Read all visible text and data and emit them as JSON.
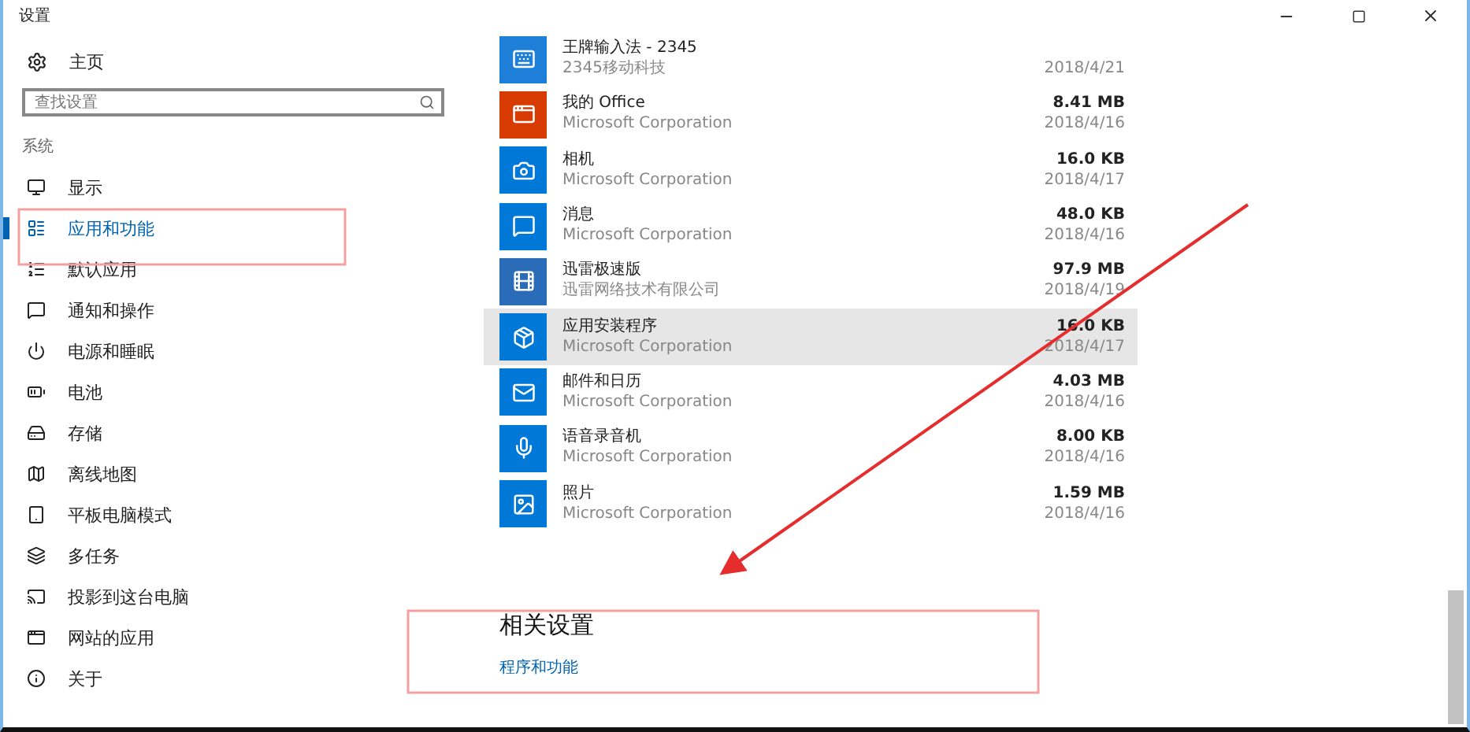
{
  "window": {
    "title": "设置"
  },
  "sidebar": {
    "home": "主页",
    "search": {
      "placeholder": "查找设置"
    },
    "section": "系统",
    "items": [
      {
        "label": "显示",
        "selected": false
      },
      {
        "label": "应用和功能",
        "selected": true
      },
      {
        "label": "默认应用",
        "selected": false
      },
      {
        "label": "通知和操作",
        "selected": false
      },
      {
        "label": "电源和睡眠",
        "selected": false
      },
      {
        "label": "电池",
        "selected": false
      },
      {
        "label": "存储",
        "selected": false
      },
      {
        "label": "离线地图",
        "selected": false
      },
      {
        "label": "平板电脑模式",
        "selected": false
      },
      {
        "label": "多任务",
        "selected": false
      },
      {
        "label": "投影到这台电脑",
        "selected": false
      },
      {
        "label": "网站的应用",
        "selected": false
      },
      {
        "label": "关于",
        "selected": false
      }
    ]
  },
  "apps": [
    {
      "name": "王牌输入法 - 2345",
      "publisher": "2345移动科技",
      "date": "2018/4/21",
      "color": "#1e7fd8",
      "selected": false
    },
    {
      "name": "我的 Office",
      "publisher": "Microsoft Corporation",
      "size": "8.41 MB",
      "date": "2018/4/16",
      "color": "#d83b01",
      "selected": false
    },
    {
      "name": "相机",
      "publisher": "Microsoft Corporation",
      "size": "16.0 KB",
      "date": "2018/4/17",
      "color": "#0078d7",
      "selected": false
    },
    {
      "name": "消息",
      "publisher": "Microsoft Corporation",
      "size": "48.0 KB",
      "date": "2018/4/16",
      "color": "#0078d7",
      "selected": false
    },
    {
      "name": "迅雷极速版",
      "publisher": "迅雷网络技术有限公司",
      "size": "97.9 MB",
      "date": "2018/4/19",
      "color": "#2b6cb8",
      "selected": false
    },
    {
      "name": "应用安装程序",
      "publisher": "Microsoft Corporation",
      "size": "16.0 KB",
      "date": "2018/4/17",
      "color": "#0078d7",
      "selected": true
    },
    {
      "name": "邮件和日历",
      "publisher": "Microsoft Corporation",
      "size": "4.03 MB",
      "date": "2018/4/16",
      "color": "#0078d7",
      "selected": false
    },
    {
      "name": "语音录音机",
      "publisher": "Microsoft Corporation",
      "size": "8.00 KB",
      "date": "2018/4/16",
      "color": "#0078d7",
      "selected": false
    },
    {
      "name": "照片",
      "publisher": "Microsoft Corporation",
      "size": "1.59 MB",
      "date": "2018/4/16",
      "color": "#0078d7",
      "selected": false
    }
  ],
  "related": {
    "title": "相关设置",
    "link": "程序和功能"
  }
}
